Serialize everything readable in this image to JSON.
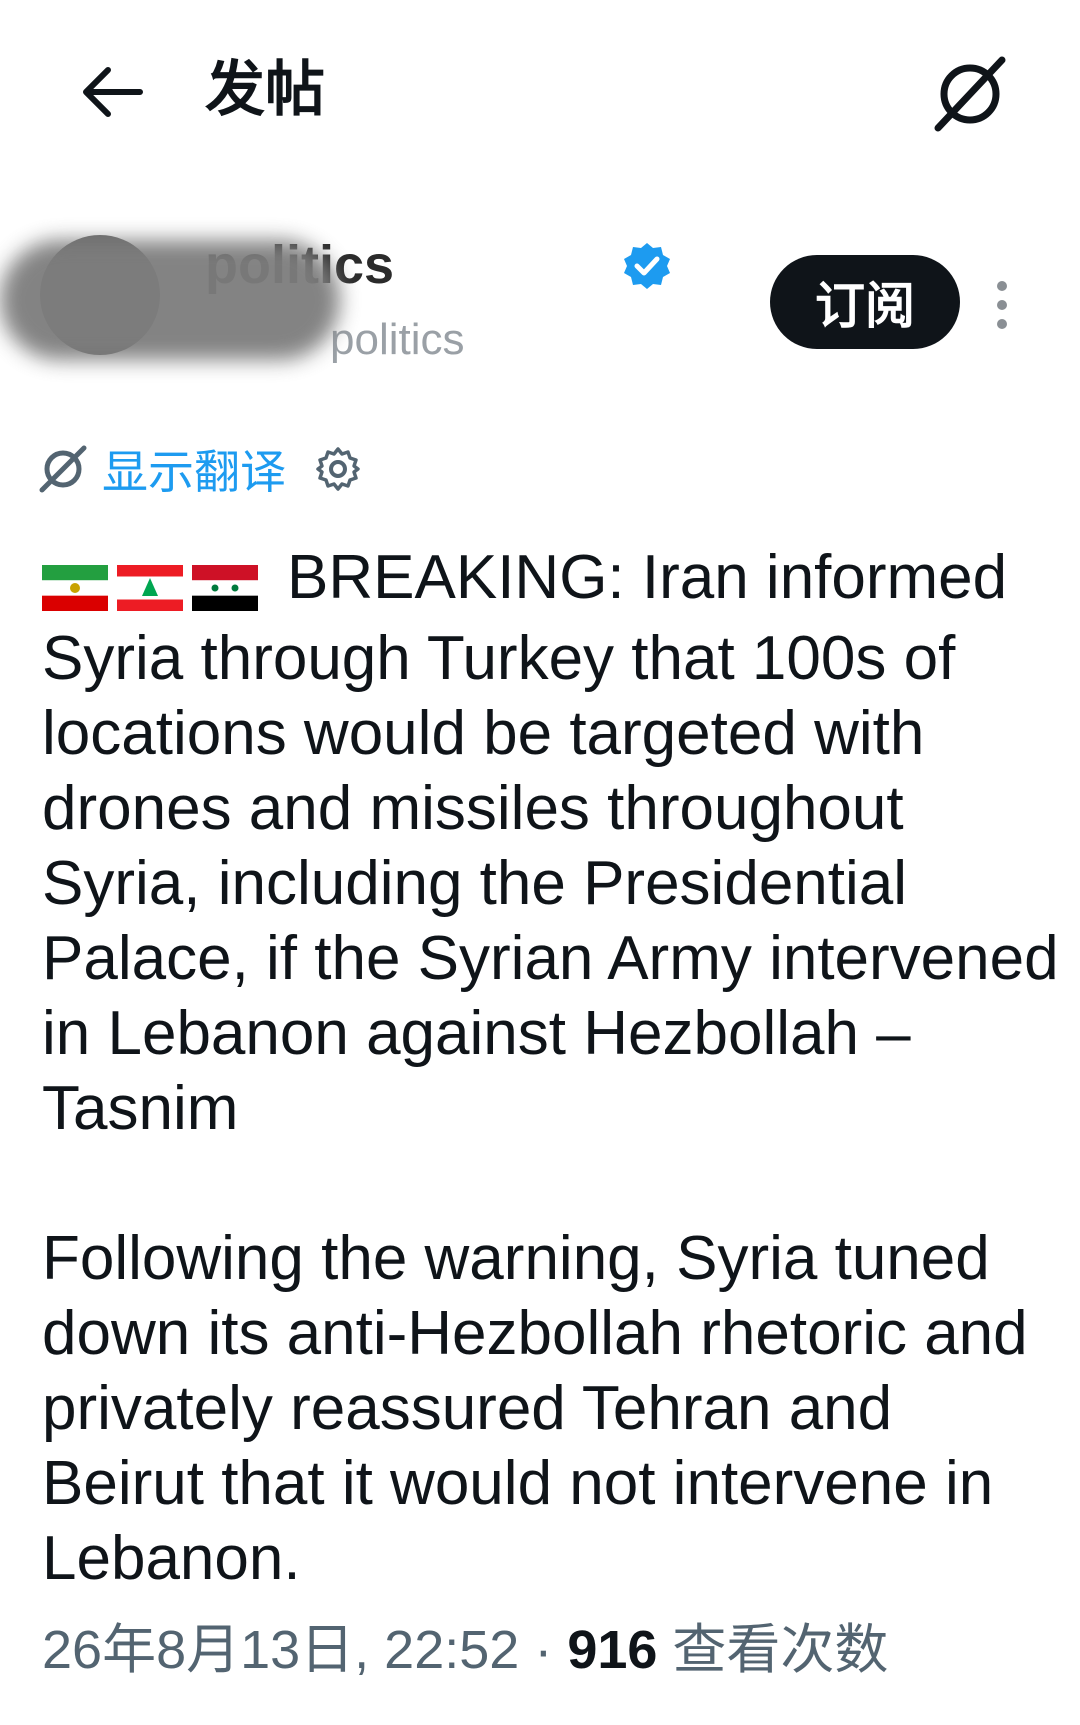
{
  "header": {
    "title": "发帖",
    "back_icon": "arrow-left-icon",
    "grok_icon": "grok-icon"
  },
  "author": {
    "display_name": "politics",
    "handle": "politics",
    "verified_icon": "verified-badge-icon",
    "subscribe_label": "订阅"
  },
  "translate": {
    "label": "显示翻译",
    "icon": "translate-icon",
    "settings_icon": "gear-icon"
  },
  "tweet": {
    "flags": [
      "Iran",
      "Lebanon",
      "Syria"
    ],
    "paragraph1": "BREAKING: Iran informed Syria through Turkey that 100s of locations would be targeted with drones and missiles throughout Syria, including the Presidential Palace, if the Syrian Army intervened in Lebanon against Hezbollah – Tasnim",
    "paragraph2": "Following the warning, Syria tuned down its anti-Hezbollah rhetoric and privately reassured Tehran and Beirut that it would not intervene in Lebanon."
  },
  "meta": {
    "timestamp": "26年8月13日, 22:52",
    "separator": " · ",
    "views_count": "916",
    "views_label": " 查看次数"
  },
  "colors": {
    "link_blue": "#1d9bf0",
    "text_dark": "#0f1419",
    "text_muted": "#536471"
  }
}
